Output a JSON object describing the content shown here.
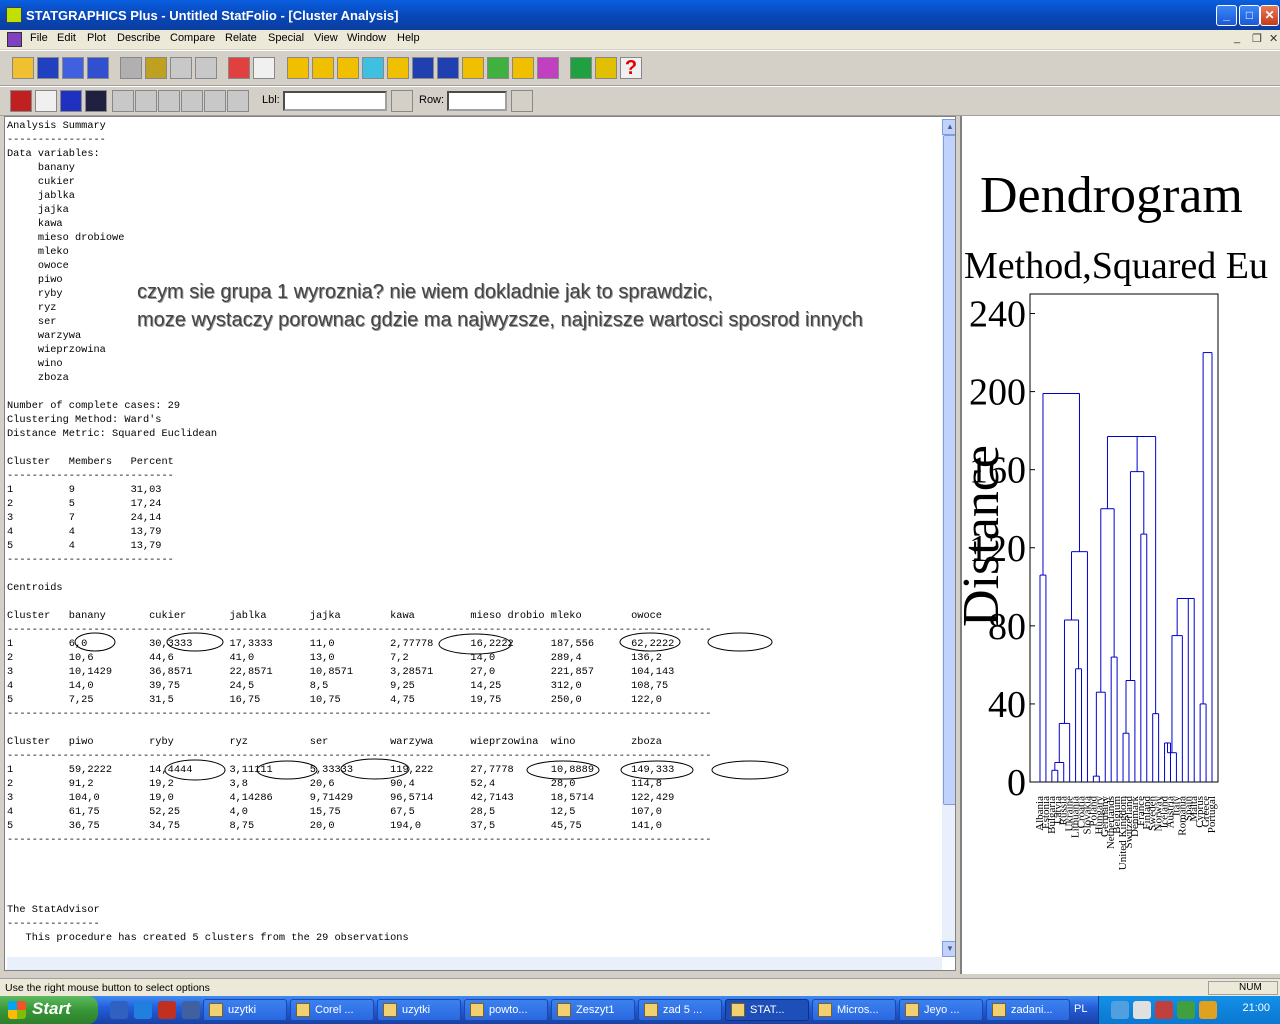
{
  "window": {
    "title": "STATGRAPHICS Plus - Untitled StatFolio - [Cluster Analysis]"
  },
  "menu": [
    "File",
    "Edit",
    "Plot",
    "Describe",
    "Compare",
    "Relate",
    "Special",
    "View",
    "Window",
    "Help"
  ],
  "toolbar2": {
    "lbl_label": "Lbl:",
    "row_label": "Row:"
  },
  "report": {
    "lines": [
      "Analysis Summary",
      "----------------",
      "Data variables:",
      "     banany",
      "     cukier",
      "     jablka",
      "     jajka",
      "     kawa",
      "     mieso drobiowe",
      "     mleko",
      "     owoce",
      "     piwo",
      "     ryby",
      "     ryz",
      "     ser",
      "     warzywa",
      "     wieprzowina",
      "     wino",
      "     zboza",
      "",
      "Number of complete cases: 29",
      "Clustering Method: Ward's",
      "Distance Metric: Squared Euclidean",
      "",
      "Cluster   Members   Percent",
      "---------------------------",
      "1         9         31,03",
      "2         5         17,24",
      "3         7         24,14",
      "4         4         13,79",
      "5         4         13,79",
      "---------------------------",
      "",
      "Centroids",
      "",
      "Cluster   banany       cukier       jablka       jajka        kawa         mieso drobio mleko        owoce",
      "------------------------------------------------------------------------------------------------------------------",
      "1         6,0          30,3333      17,3333      11,0         2,77778      16,2222      187,556      62,2222",
      "2         10,6         44,6         41,0         13,0         7,2          14,0         289,4        136,2",
      "3         10,1429      36,8571      22,8571      10,8571      3,28571      27,0         221,857      104,143",
      "4         14,0         39,75        24,5         8,5          9,25         14,25        312,0        108,75",
      "5         7,25         31,5         16,75        10,75        4,75         19,75        250,0        122,0",
      "------------------------------------------------------------------------------------------------------------------",
      "",
      "Cluster   piwo         ryby         ryz          ser          warzywa      wieprzowina  wino         zboza",
      "------------------------------------------------------------------------------------------------------------------",
      "1         59,2222      14,4444      3,11111      5,33333      119,222      27,7778      10,8889      149,333",
      "2         91,2         19,2         3,8          20,6         90,4         52,4         28,0         114,8",
      "3         104,0        19,0         4,14286      9,71429      96,5714      42,7143      18,5714      122,429",
      "4         61,75        52,25        4,0          15,75        67,5         28,5         12,5         107,0",
      "5         36,75        34,75        8,75         20,0         194,0        37,5         45,75        141,0",
      "------------------------------------------------------------------------------------------------------------------",
      "",
      "",
      "",
      "",
      "The StatAdvisor",
      "---------------",
      "   This procedure has created 5 clusters from the 29 observations"
    ]
  },
  "overlay": {
    "line1": "czym sie grupa 1 wyroznia? nie wiem dokladnie jak to sprawdzic,",
    "line2": "moze wystaczy porownac gdzie ma najwyzsze, najnizsze wartosci sposrod innych"
  },
  "dendrogram": {
    "title": "Dendrogram",
    "subtitle": "Method,Squared Eu",
    "ylabel": "Distance",
    "yticks": [
      "0",
      "40",
      "80",
      "120",
      "160",
      "200",
      "240"
    ],
    "ymax": 250,
    "leaf_labels": [
      "Albania",
      "Estonia",
      "Bulgaria",
      "Latvia",
      "Russia",
      "Ukraine",
      "Lithuania",
      "Croatia",
      "Slovakia",
      "Poland",
      "Hungary",
      "Germany",
      "Netherlands",
      "Belgium",
      "United Kingdom",
      "Switzerland",
      "Denmark",
      "France",
      "Finland",
      "Sweden",
      "Norway",
      "Iceland",
      "Austria",
      "Italy",
      "Romania",
      "Spain",
      "Malta",
      "Cyprus",
      "Greece",
      "Portugal"
    ],
    "line_color": "#0000cc"
  },
  "status": {
    "text": "Use the right mouse button to select options",
    "num": "NUM"
  },
  "taskbar": {
    "start": "Start",
    "tasks": [
      "uzytki",
      "Corel ...",
      "uzytki",
      "powto...",
      "Zeszyt1",
      "zad 5 ...",
      "STAT...",
      "Micros...",
      "Jeyo ...",
      "zadani..."
    ],
    "lang": "PL",
    "clock": "21:00"
  }
}
